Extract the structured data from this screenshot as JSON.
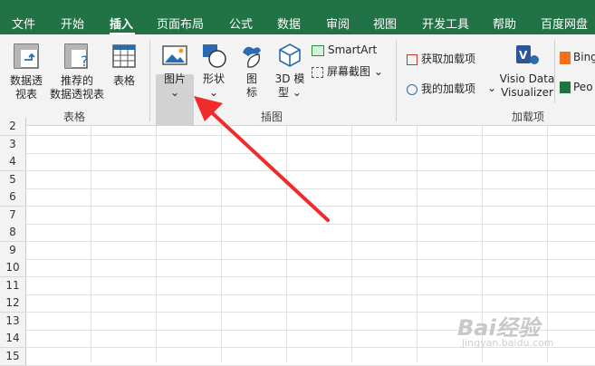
{
  "tabs": [
    {
      "label": "文件"
    },
    {
      "label": "开始"
    },
    {
      "label": "插入"
    },
    {
      "label": "页面布局"
    },
    {
      "label": "公式"
    },
    {
      "label": "数据"
    },
    {
      "label": "审阅"
    },
    {
      "label": "视图"
    },
    {
      "label": "开发工具"
    },
    {
      "label": "帮助"
    },
    {
      "label": "百度网盘"
    }
  ],
  "active_tab": "插入",
  "ribbon": {
    "tables_group": {
      "label": "表格",
      "pivot_line1": "数据透",
      "pivot_line2": "视表",
      "recommended_line1": "推荐的",
      "recommended_line2": "数据透视表",
      "table_label": "表格"
    },
    "illustrations_group": {
      "label": "插图",
      "picture": "图片",
      "shapes": "形状",
      "icons_line1": "图",
      "icons_line2": "标",
      "model_line1": "3D 模",
      "model_line2": "型",
      "smartart": "SmartArt",
      "screenshot": "屏幕截图"
    },
    "addins_group": {
      "label": "加载项",
      "get_addins": "获取加载项",
      "my_addins": "我的加载项",
      "visio_line1": "Visio Data",
      "visio_line2": "Visualizer",
      "bing": "Bing",
      "people": "Peo"
    }
  },
  "rows": [
    "2",
    "3",
    "4",
    "5",
    "6",
    "7",
    "8",
    "9",
    "10",
    "11",
    "12",
    "13",
    "14",
    "15"
  ],
  "watermark": {
    "text": "Bai经验",
    "sub": "jingyan.baidu.com"
  },
  "colors": {
    "brand": "#217346",
    "arrow": "#ef2b2b"
  }
}
